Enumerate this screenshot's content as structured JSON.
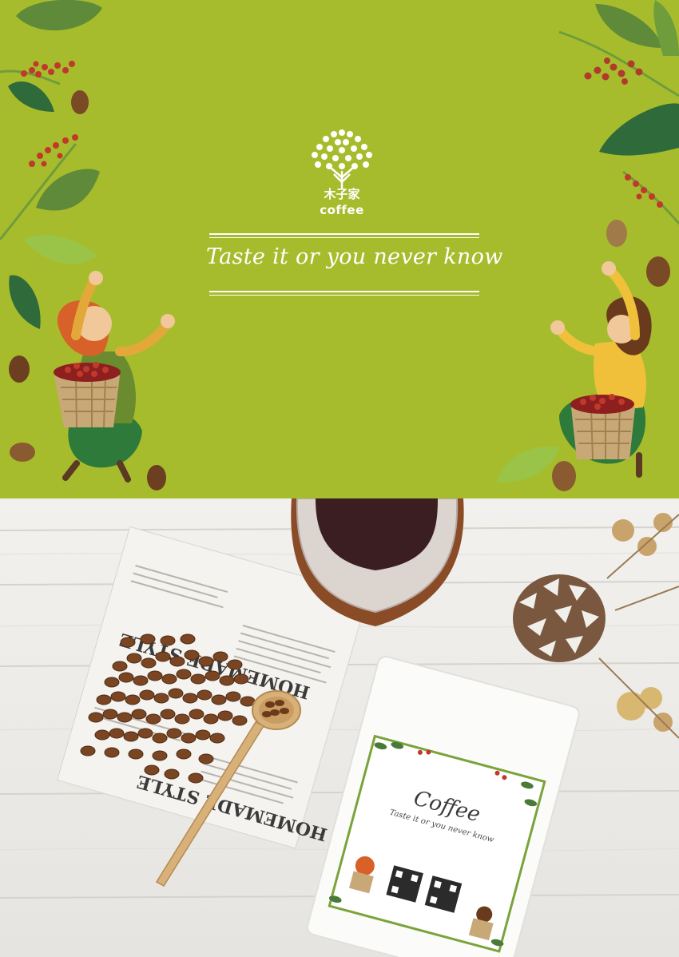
{
  "banner": {
    "background_color": "#a7bc2c",
    "brand_word": "coffee",
    "tagline": "Taste it or you never know",
    "logo_icon": "coffee-tree-logo-icon"
  },
  "photo": {
    "newspaper_headline_1": "HOMEMADE STYLE",
    "newspaper_headline_2": "HOMEMADE STYLE",
    "package_brand": "Coffee",
    "package_tagline": "Taste it or you never know"
  }
}
